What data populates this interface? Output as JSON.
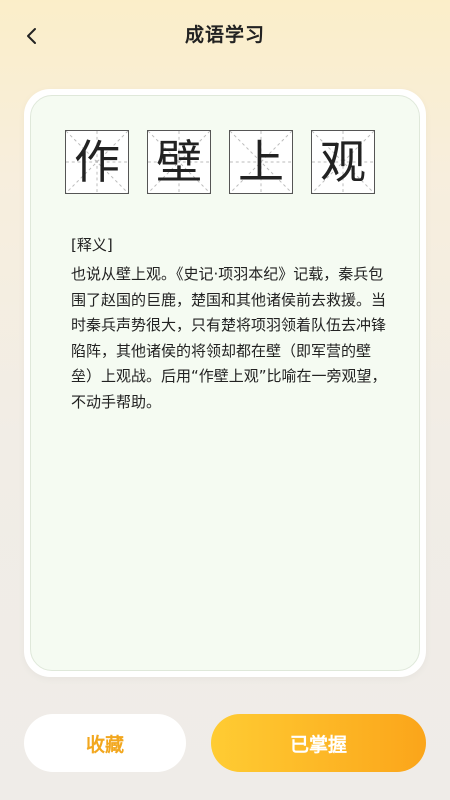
{
  "header": {
    "title": "成语学习"
  },
  "idiom": {
    "characters": [
      "作",
      "壁",
      "上",
      "观"
    ]
  },
  "explanation": {
    "label": "[释义]",
    "text": "也说从壁上观。《史记·项羽本纪》记载，秦兵包围了赵国的巨鹿，楚国和其他诸侯前去救援。当时秦兵声势很大，只有楚将项羽领着队伍去冲锋陷阵，其他诸侯的将领却都在壁（即军营的壁垒）上观战。后用“作壁上观”比喻在一旁观望，不动手帮助。"
  },
  "actions": {
    "collect_label": "收藏",
    "mastered_label": "已掌握"
  },
  "colors": {
    "accent": "#fba51a",
    "accent_light": "#ffcc33",
    "collect_text": "#f2a71e"
  }
}
